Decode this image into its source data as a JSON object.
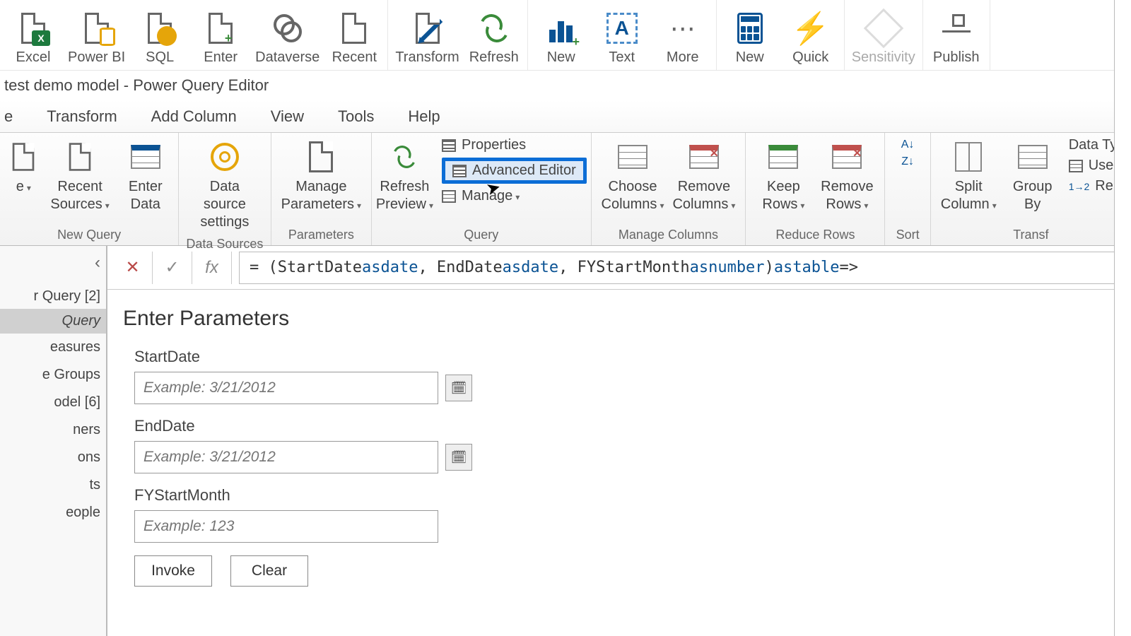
{
  "topRibbon": {
    "excel": "Excel",
    "powerbi": "Power BI",
    "sql": "SQL",
    "enter": "Enter",
    "dataverse": "Dataverse",
    "recent": "Recent",
    "transform": "Transform",
    "refresh": "Refresh",
    "newVisual": "New",
    "text": "Text",
    "more": "More",
    "newMeasure": "New",
    "quick": "Quick",
    "sensitivity": "Sensitivity",
    "publish": "Publish"
  },
  "windowTitle": "test demo model - Power Query Editor",
  "menuTabs": [
    "e",
    "Transform",
    "Add Column",
    "View",
    "Tools",
    "Help"
  ],
  "pqRibbon": {
    "newQuery": {
      "recentSources": "Recent\nSources",
      "enterData": "Enter\nData",
      "label": "New Query"
    },
    "dataSources": {
      "settings": "Data source\nsettings",
      "label": "Data Sources"
    },
    "parameters": {
      "manage": "Manage\nParameters",
      "label": "Parameters"
    },
    "query": {
      "refresh": "Refresh\nPreview",
      "properties": "Properties",
      "advanced": "Advanced Editor",
      "manage": "Manage",
      "label": "Query"
    },
    "manageColumns": {
      "choose": "Choose\nColumns",
      "remove": "Remove\nColumns",
      "label": "Manage Columns"
    },
    "reduceRows": {
      "keep": "Keep\nRows",
      "remove": "Remove\nRows",
      "label": "Reduce Rows"
    },
    "sort": {
      "label": "Sort"
    },
    "transform": {
      "split": "Split\nColumn",
      "group": "Group\nBy",
      "dataType": "Data Ty",
      "use": "Use",
      "rep": "Rep",
      "label": "Transf"
    }
  },
  "sidebar": {
    "heading": "r Query [2]",
    "selected": "Query",
    "items": [
      "easures",
      "e Groups",
      "odel [6]",
      "ners",
      "ons",
      "ts",
      "eople"
    ]
  },
  "formula": {
    "prefix": "= (StartDate ",
    "as1": "as",
    "date1": " date",
    "mid1": ", EndDate ",
    "as2": "as",
    "date2": " date",
    "mid2": ", FYStartMonth ",
    "as3": "as",
    "num": " number",
    "mid3": ") ",
    "as4": "as",
    "tbl": " table",
    "end": " =>"
  },
  "params": {
    "title": "Enter Parameters",
    "fields": [
      {
        "label": "StartDate",
        "placeholder": "Example: 3/21/2012",
        "datepicker": true
      },
      {
        "label": "EndDate",
        "placeholder": "Example: 3/21/2012",
        "datepicker": true
      },
      {
        "label": "FYStartMonth",
        "placeholder": "Example: 123",
        "datepicker": false
      }
    ],
    "invoke": "Invoke",
    "clear": "Clear"
  }
}
